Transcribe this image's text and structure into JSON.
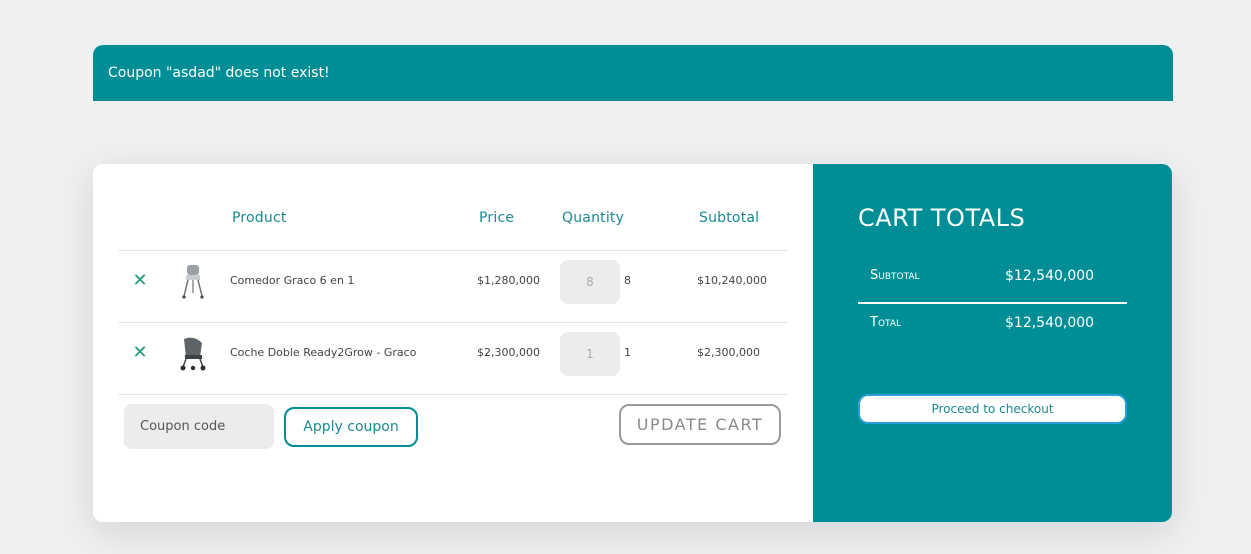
{
  "notice": {
    "message": "Coupon \"asdad\" does not exist!"
  },
  "cart": {
    "headers": {
      "product": "Product",
      "price": "Price",
      "quantity": "Quantity",
      "subtotal": "Subtotal"
    },
    "items": [
      {
        "remove_icon": "close-icon",
        "name": "Comedor Graco 6 en 1",
        "price": "$1,280,000",
        "qty_input": "8",
        "qty": "8",
        "subtotal": "$10,240,000"
      },
      {
        "remove_icon": "close-icon",
        "name": "Coche Doble Ready2Grow - Graco",
        "price": "$2,300,000",
        "qty_input": "1",
        "qty": "1",
        "subtotal": "$2,300,000"
      }
    ],
    "coupon": {
      "placeholder": "Coupon code",
      "apply_label": "Apply coupon"
    },
    "update_label": "UPDATE CART"
  },
  "totals": {
    "title": "CART TOTALS",
    "subtotal_label": "Subtotal",
    "subtotal_value": "$12,540,000",
    "total_label": "Total",
    "total_value": "$12,540,000",
    "checkout_label": "Proceed to checkout"
  },
  "colors": {
    "accent": "#008e96",
    "remove": "#1f9b7a",
    "checkout_border": "#2a9fd6"
  }
}
